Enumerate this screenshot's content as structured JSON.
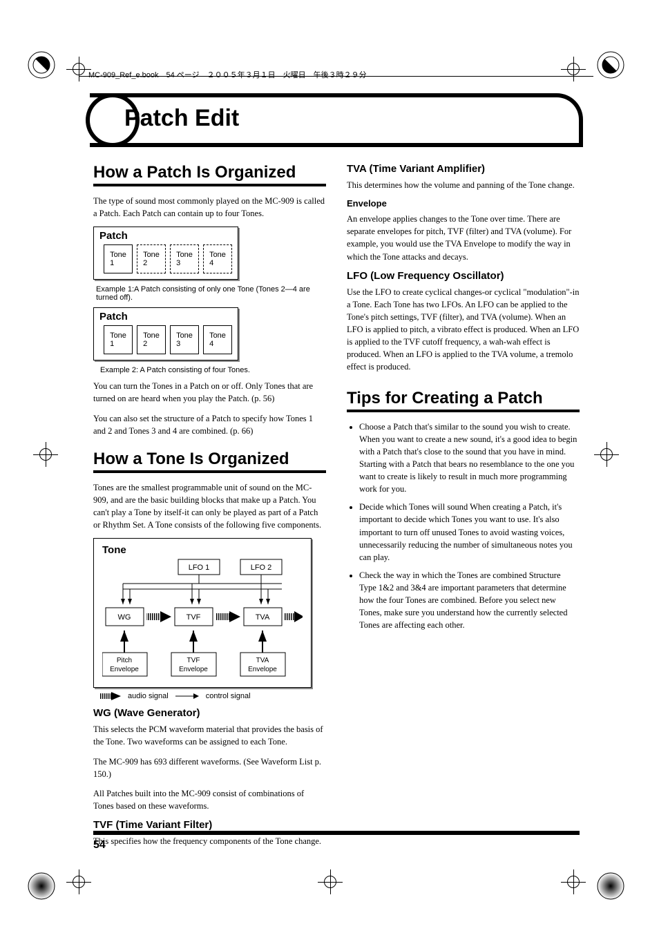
{
  "header": {
    "framemaker_line": "MC-909_Ref_e.book　54 ページ　２００５年３月１日　火曜日　午後３時２９分"
  },
  "title": "Patch Edit",
  "page_number": "54",
  "left": {
    "h1_a": "How a Patch Is Organized",
    "intro": "The type of sound most commonly played on the MC-909 is called a Patch. Each Patch can contain up to four Tones.",
    "patch_label": "Patch",
    "tones": {
      "t1": "Tone 1",
      "t2": "Tone 2",
      "t3": "Tone 3",
      "t4": "Tone 4"
    },
    "ex1_caption": "Example 1:A Patch consisting of only one Tone (Tones 2—4 are turned off).",
    "ex2_caption": "Example 2: A Patch consisting of four Tones.",
    "p_turn": "You can turn the Tones in a Patch on or off. Only Tones that are turned on are heard when you play the Patch. (p. 56)",
    "p_struct": "You can also set the structure of a Patch to specify how Tones 1 and 2 and Tones 3 and 4 are combined. (p. 66)",
    "h1_b": "How a Tone Is Organized",
    "tone_intro": "Tones are the smallest programmable unit of sound on the MC-909, and are the basic building blocks that make up a Patch. You can't play a Tone by itself-it can only be played as part of a Patch or Rhythm Set. A Tone consists of the following five components.",
    "tone_box": {
      "title": "Tone",
      "lfo1": "LFO 1",
      "lfo2": "LFO 2",
      "wg": "WG",
      "tvf": "TVF",
      "tva": "TVA",
      "pe": "Pitch Envelope",
      "fe": "TVF Envelope",
      "ae": "TVA Envelope"
    },
    "legend": {
      "audio": "audio signal",
      "control": "control signal"
    },
    "wg_h": "WG (Wave Generator)",
    "wg_p1": "This selects the PCM waveform material that provides the basis of the Tone. Two waveforms can be assigned to each Tone.",
    "wg_p2": "The MC-909 has 693 different waveforms. (See Waveform List p. 150.)",
    "wg_p3": "All Patches built into the MC-909 consist of combinations of Tones based on these waveforms.",
    "tvf_h": "TVF (Time Variant Filter)",
    "tvf_p": "This specifies how the frequency components of the Tone change."
  },
  "right": {
    "tva_h": "TVA (Time Variant Amplifier)",
    "tva_p": "This determines how the volume and panning of the Tone change.",
    "env_h": "Envelope",
    "env_p": "An envelope applies changes to the Tone over time. There are separate envelopes for pitch, TVF (filter) and TVA (volume). For example, you would use the TVA Envelope to modify the way in which the Tone attacks and decays.",
    "lfo_h": "LFO (Low Frequency Oscillator)",
    "lfo_p": "Use the LFO to create cyclical changes-or cyclical \"modulation\"-in a Tone. Each Tone has two LFOs. An LFO can be applied to the Tone's pitch settings, TVF (filter), and TVA (volume). When an LFO is applied to pitch, a vibrato effect is produced. When an LFO is applied to the TVF cutoff frequency, a wah-wah effect is produced. When an LFO is applied to the TVA volume, a tremolo effect is produced.",
    "h1": "Tips for Creating a Patch",
    "tips": [
      "Choose a Patch that's similar to the sound you wish to create. When you want to create a new sound, it's a good idea to begin with a Patch that's close to the sound that you have in mind. Starting with a Patch that bears no resemblance to the one you want to create is likely to result in much more programming work for you.",
      "Decide which Tones will sound\nWhen creating a Patch, it's important to decide which Tones you want to use. It's also important to turn off unused Tones to avoid wasting voices, unnecessarily reducing the number of simultaneous notes you can play.",
      "Check the way in which the Tones are combined\nStructure Type 1&2 and 3&4 are important parameters that determine how the four Tones are combined. Before you select new Tones, make sure you understand how the currently selected Tones are affecting each other."
    ]
  }
}
